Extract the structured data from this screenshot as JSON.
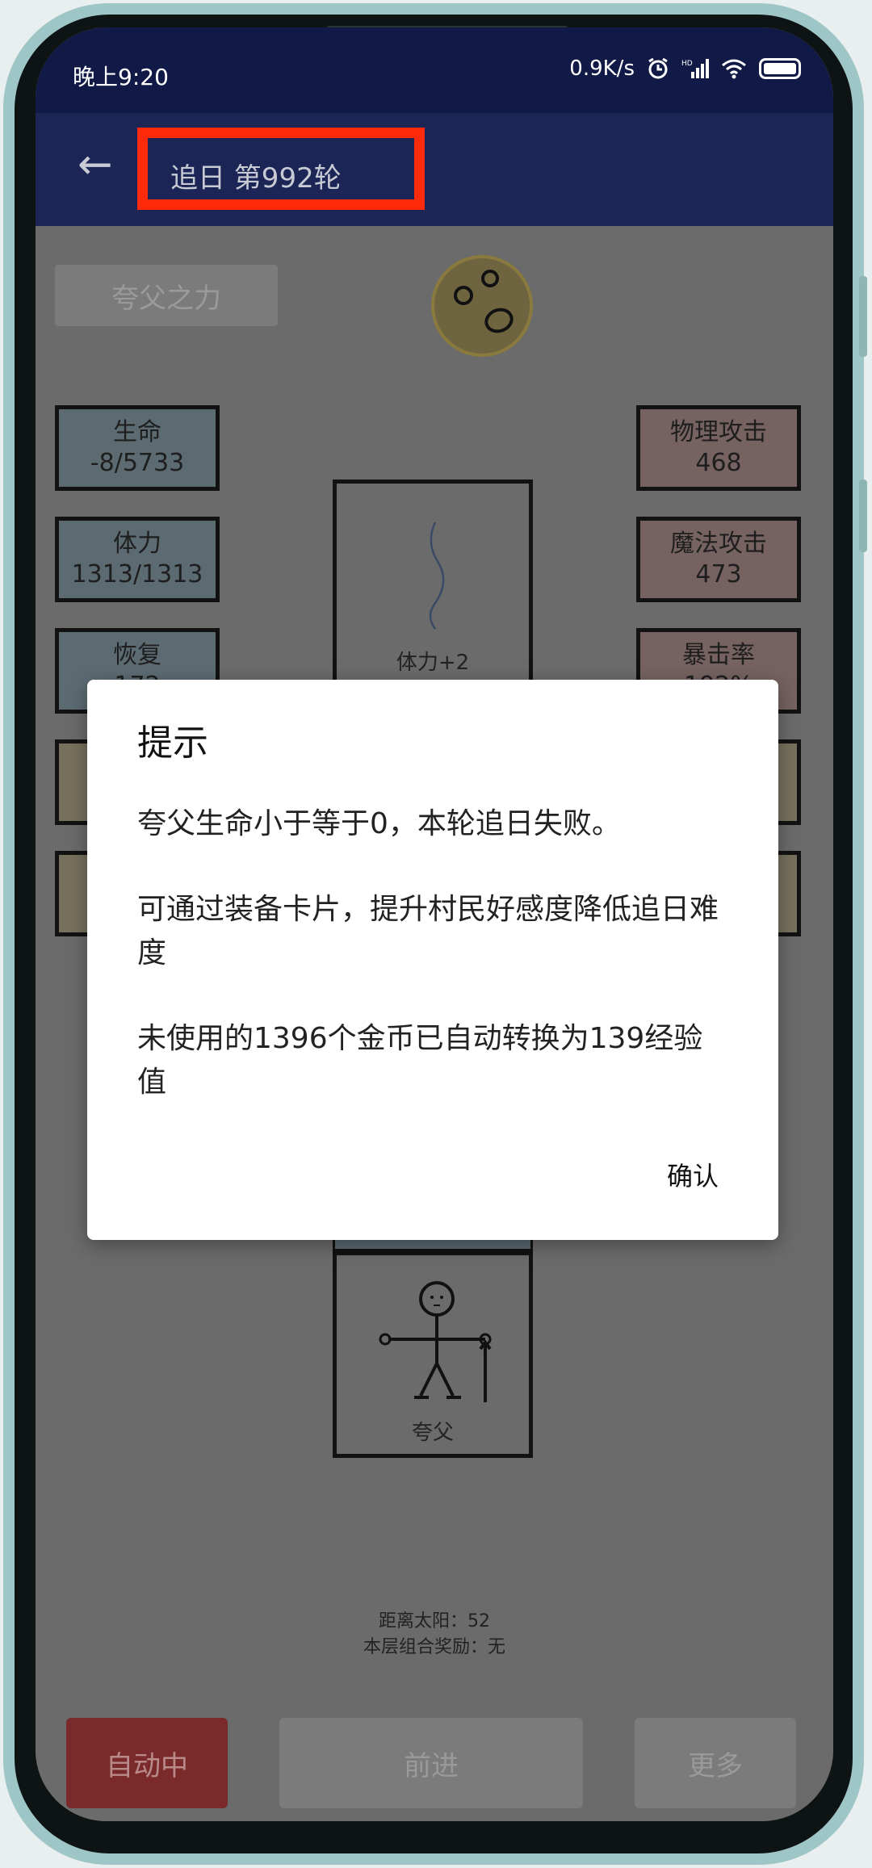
{
  "status_bar": {
    "time": "晚上9:20",
    "net_speed": "0.9K/s"
  },
  "app_bar": {
    "back_icon": "arrow-left-icon",
    "title": "追日 第992轮"
  },
  "game": {
    "power_button": "夸父之力",
    "left_stats": [
      {
        "label": "生命",
        "value": "-8/5733"
      },
      {
        "label": "体力",
        "value": "1313/1313"
      },
      {
        "label": "恢复",
        "value": "172"
      }
    ],
    "right_stats": [
      {
        "label": "物理攻击",
        "value": "468"
      },
      {
        "label": "魔法攻击",
        "value": "473"
      },
      {
        "label": "暴击率",
        "value": "192%"
      }
    ],
    "event_card_label": "体力+2",
    "character_label": "夸父",
    "distance_to_sun": "距离太阳：52",
    "layer_bonus": "本层组合奖励：无",
    "auto_button": "自动中",
    "forward_button": "前进",
    "more_button": "更多"
  },
  "dialog": {
    "title": "提示",
    "line1": "夸父生命小于等于0，本轮追日失败。",
    "line2": "可通过装备卡片，提升村民好感度降低追日难度",
    "line3": "未使用的1396个金币已自动转换为139经验值",
    "confirm": "确认"
  },
  "colors": {
    "status_bar": "#111a46",
    "app_bar": "#1b2556",
    "highlight_box": "#ff2a0a",
    "auto_button": "#7a2a2a"
  }
}
